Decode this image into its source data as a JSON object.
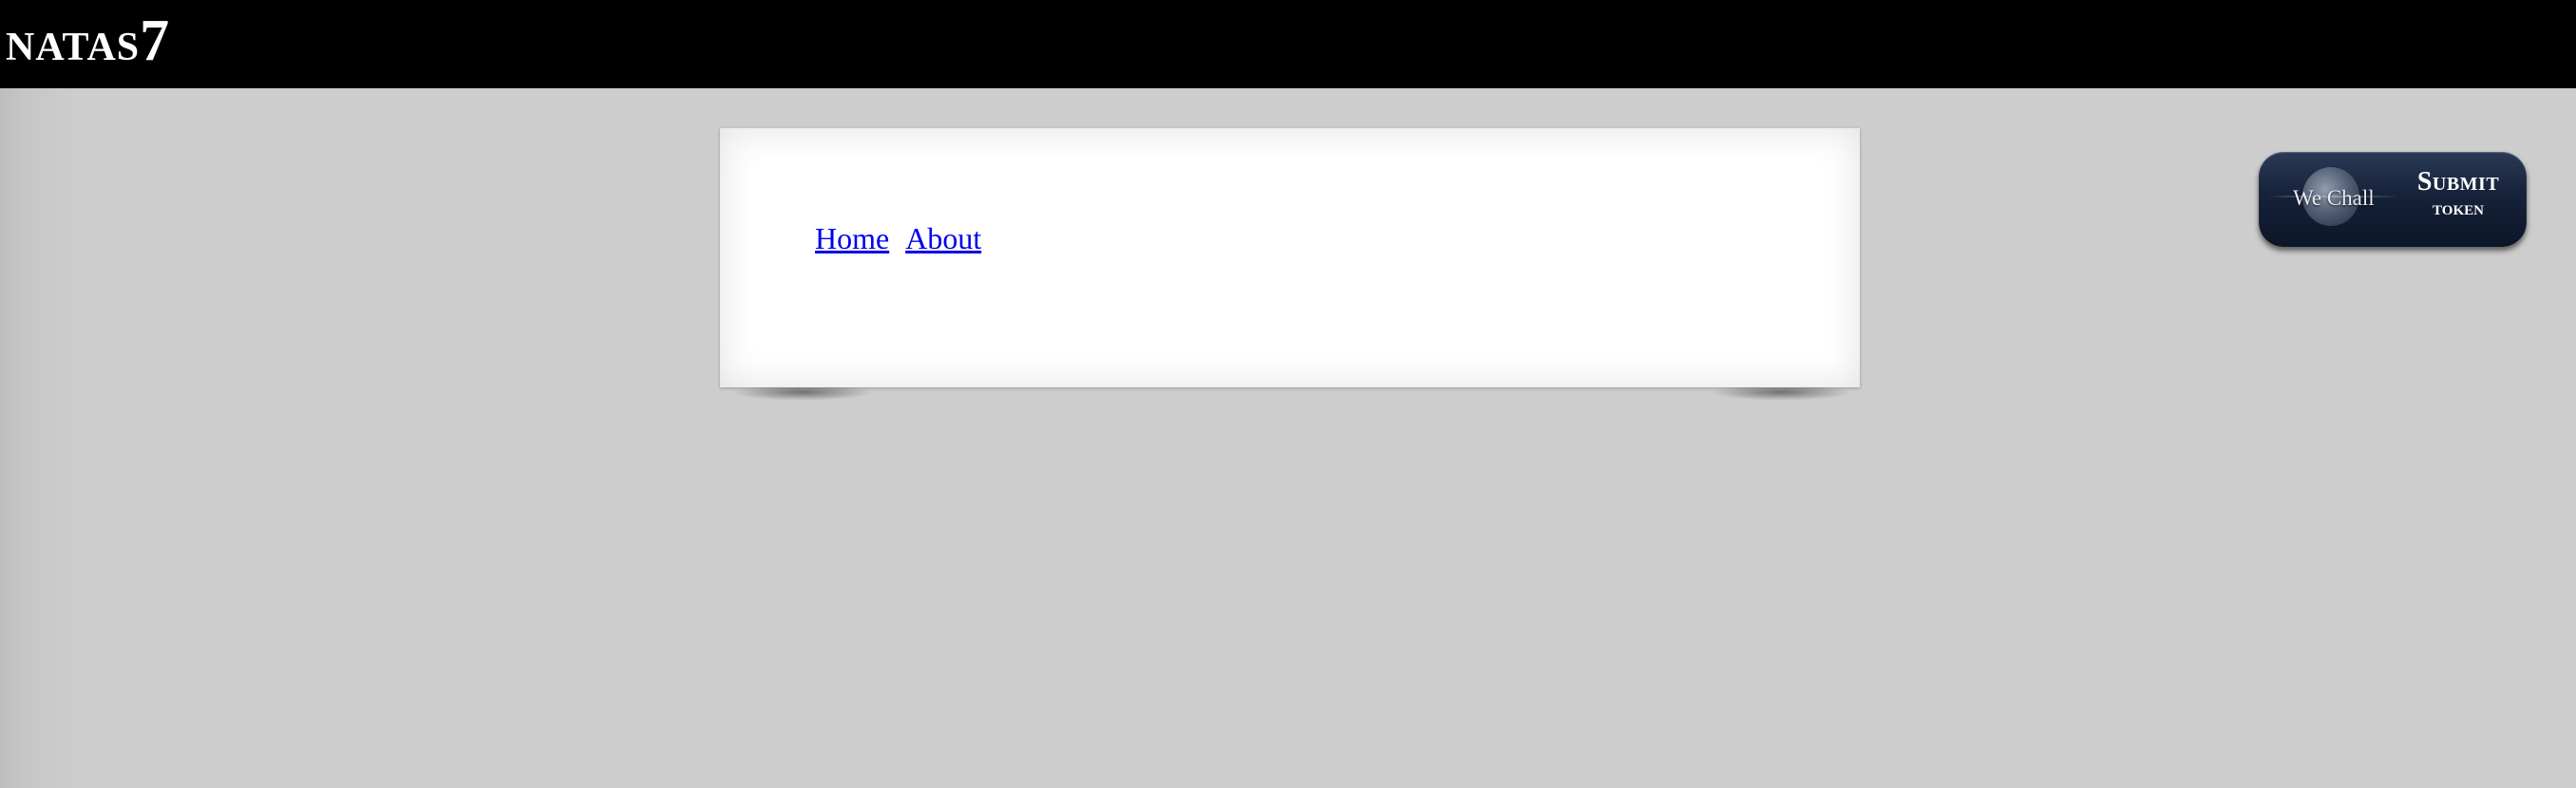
{
  "header": {
    "title_main": "NATAS",
    "title_num": "7"
  },
  "nav": {
    "home_label": "Home",
    "about_label": "About"
  },
  "wechall": {
    "logo_text": "We Chall",
    "submit_line1": "Submit",
    "submit_line2": "token"
  },
  "colors": {
    "header_bg": "#000000",
    "page_bg": "#cdcdcd",
    "link": "#0000ee",
    "badge_bg": "#16223a"
  },
  "icons": [
    "wechall-globe-icon"
  ]
}
